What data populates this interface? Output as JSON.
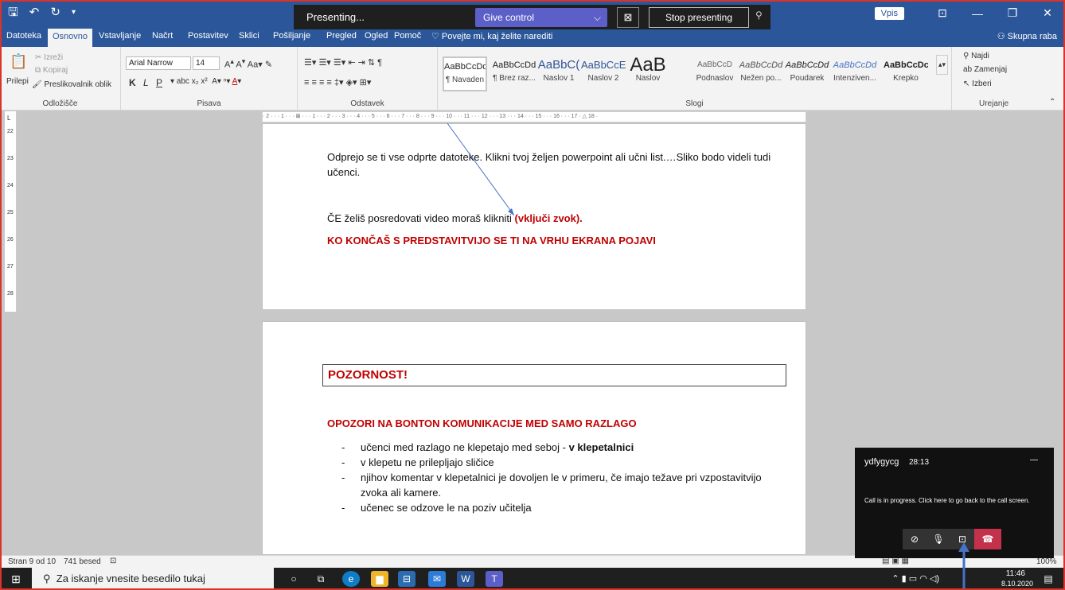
{
  "titlebar": {
    "qat": [
      "save-icon",
      "undo-icon",
      "redo-icon",
      "customize-icon"
    ],
    "vpis_label": "Vpis",
    "window_controls": [
      "ribbon-display-icon",
      "minimize-icon",
      "maximize-icon",
      "close-icon"
    ]
  },
  "presenting": {
    "status": "Presenting...",
    "give_control": "Give control",
    "stop": "Stop presenting"
  },
  "tabs": {
    "items": [
      "Datoteka",
      "Osnovno",
      "Vstavljanje",
      "Načrt",
      "Postavitev",
      "Sklici",
      "Pošiljanje",
      "Pregled",
      "Ogled",
      "Pomoč"
    ],
    "tell_me": "Povejte mi, kaj želite narediti",
    "share": "Skupna raba"
  },
  "ribbon": {
    "clipboard": {
      "label": "Odložišče",
      "paste": "Prilepi",
      "cut": "Izreži",
      "copy": "Kopiraj",
      "format_painter": "Preslikovalnik oblik"
    },
    "font": {
      "label": "Pisava",
      "font_name": "Arial Narrow",
      "font_size": "14"
    },
    "paragraph": {
      "label": "Odstavek"
    },
    "styles": {
      "label": "Slogi",
      "items": [
        {
          "preview": "AaBbCcDd",
          "name": "¶ Navaden"
        },
        {
          "preview": "AaBbCcDd",
          "name": "¶ Brez raz..."
        },
        {
          "preview": "AaBbC(",
          "name": "Naslov 1"
        },
        {
          "preview": "AaBbCcE",
          "name": "Naslov 2"
        },
        {
          "preview": "AaB",
          "name": "Naslov"
        },
        {
          "preview": "AaBbCcD",
          "name": "Podnaslov"
        },
        {
          "preview": "AaBbCcDd",
          "name": "Nežen po..."
        },
        {
          "preview": "AaBbCcDd",
          "name": "Poudarek"
        },
        {
          "preview": "AaBbCcDd",
          "name": "Intenziven..."
        },
        {
          "preview": "AaBbCcDc",
          "name": "Krepko"
        }
      ]
    },
    "editing": {
      "label": "Urejanje",
      "find": "Najdi",
      "replace": "Zamenjaj",
      "select": "Izberi"
    }
  },
  "ruler_ticks": "· 2 · · · 1 · · · ⊠ · · · 1 · · · 2 · · · 3 · · · 4 · · · 5 · · · 6 · · · 7 · · · 8 · · · 9 · · · 10 · · · 11 · · · 12 · · · 13 · · · 14 · · · 15 · · · 16 · · · 17 · △ 18 ·",
  "vruler_ticks": [
    "22",
    "23",
    "24",
    "25",
    "26",
    "27",
    "28"
  ],
  "page1": {
    "p1_line1": "Odprejo se ti vse odprte datoteke. Klikni tvoj željen powerpoint ali učni list.…Sliko bodo videli tudi",
    "p1_line2": "učenci.",
    "p2_text": "ČE želiš posredovati video moraš klikniti ",
    "p2_red": "(vključi zvok).",
    "p3_red": "KO KONČAŠ S PREDSTAVITVIJO SE TI NA VRHU EKRANA POJAVI"
  },
  "page2": {
    "heading": "POZORNOST!",
    "subheading": "OPOZORI NA BONTON KOMUNIKACIJE MED SAMO RAZLAGO",
    "list": [
      {
        "text": "učenci med razlago ne klepetajo med seboj -  ",
        "bold": "v klepetalnici"
      },
      {
        "text": "v klepetu ne prilepljajo sličice",
        "bold": ""
      },
      {
        "text": "njihov komentar v klepetalnici je dovoljen le v primeru, če imajo težave pri vzpostavitvijo zvoka ali kamere.",
        "bold": ""
      },
      {
        "text": "učenec se odzove le na poziv učitelja",
        "bold": ""
      }
    ]
  },
  "status": {
    "page": "Stran 9 od 10",
    "words": "741 besed",
    "zoom": "100%"
  },
  "call": {
    "name": "ydfygycg",
    "time": "28:13",
    "message": "Call is in progress. Click here to go back to the call screen."
  },
  "taskbar": {
    "search_placeholder": "Za iskanje vnesite besedilo tukaj",
    "time": "11:46",
    "date": "8.10.2020",
    "apps": [
      "cortana-icon",
      "task-view-icon",
      "edge-icon",
      "file-explorer-icon",
      "store-icon",
      "mail-icon",
      "word-icon",
      "teams-icon"
    ]
  },
  "colors": {
    "word_blue": "#2b579a",
    "teams_purple": "#5b5fc7",
    "hangup_red": "#c4314b",
    "heading_red": "#c00000"
  }
}
